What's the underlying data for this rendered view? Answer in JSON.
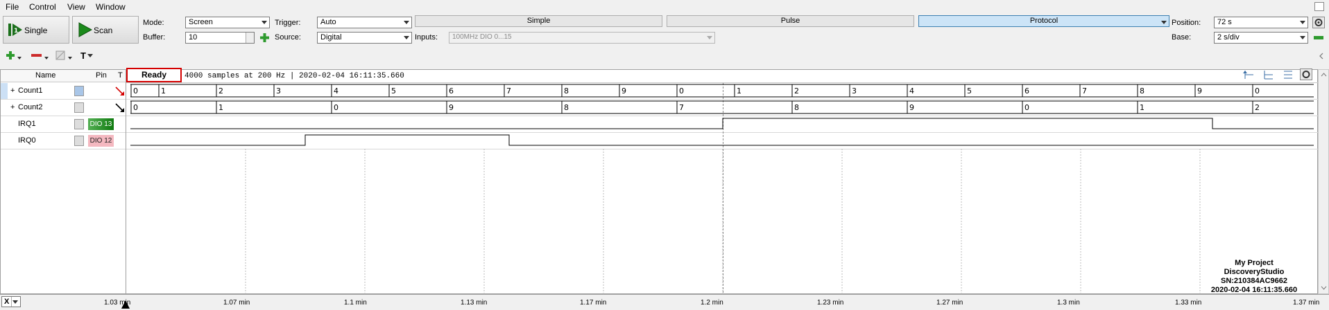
{
  "menu": [
    "File",
    "Control",
    "View",
    "Window"
  ],
  "toolbar": {
    "single_label": "Single",
    "scan_label": "Scan",
    "mode_label": "Mode:",
    "mode_value": "Screen",
    "buffer_label": "Buffer:",
    "buffer_value": "10",
    "trigger_label": "Trigger:",
    "trigger_value": "Auto",
    "source_label": "Source:",
    "source_value": "Digital",
    "inputs_label": "Inputs:",
    "inputs_value": "100MHz DIO 0...15",
    "tabs": [
      "Simple",
      "Pulse",
      "Protocol"
    ],
    "position_label": "Position:",
    "position_value": "72 s",
    "base_label": "Base:",
    "base_value": "2 s/div"
  },
  "toolbar2": {
    "t_label": "T"
  },
  "signals": {
    "headers": [
      "Name",
      "Pin",
      "T"
    ],
    "rows": [
      {
        "expander": "+",
        "name": "Count1",
        "pin": ""
      },
      {
        "expander": "+",
        "name": "Count2",
        "pin": ""
      },
      {
        "expander": "",
        "name": "IRQ1",
        "pin": "DIO 13"
      },
      {
        "expander": "",
        "name": "IRQ0",
        "pin": "DIO 12"
      }
    ]
  },
  "status": {
    "state": "Ready",
    "info": "4000 samples at 200 Hz | 2020-02-04 16:11:35.660"
  },
  "buses": {
    "count1": [
      "0",
      "1",
      "2",
      "3",
      "4",
      "5",
      "6",
      "7",
      "8",
      "9",
      "0",
      "1",
      "2",
      "3",
      "4",
      "5",
      "6",
      "7",
      "8",
      "9",
      "0"
    ],
    "count2": [
      "0",
      "1",
      "0",
      "9",
      "8",
      "7",
      "8",
      "9",
      "0",
      "1",
      "2"
    ]
  },
  "xaxis": {
    "selector": "X",
    "ticks": [
      "1.03 min",
      "1.07 min",
      "1.1 min",
      "1.13 min",
      "1.17 min",
      "1.2 min",
      "1.23 min",
      "1.27 min",
      "1.3 min",
      "1.33 min",
      "1.37 min"
    ]
  },
  "watermark": {
    "line1": "My Project",
    "line2": "DiscoveryStudio",
    "line3": "SN:210384AC9662",
    "line4": "2020-02-04 16:11:35.660"
  },
  "colors": {
    "active_tab": "#cce4f7",
    "pin_green": "#1a8a1a",
    "pin_red": "#f4b8c0",
    "ready_border": "#d40000"
  }
}
